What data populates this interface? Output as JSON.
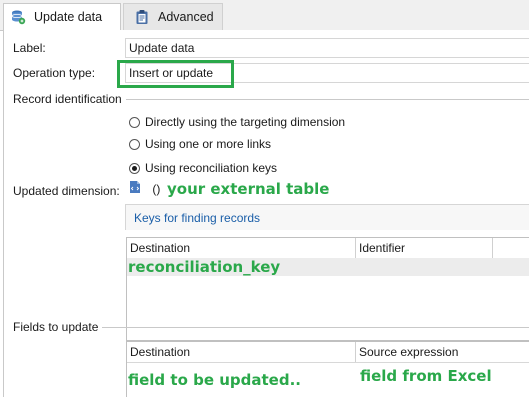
{
  "tabs": [
    {
      "label": "Update data",
      "icon": "database-icon",
      "active": true
    },
    {
      "label": "Advanced",
      "icon": "clipboard-icon",
      "active": false
    }
  ],
  "form": {
    "label_caption": "Label:",
    "label_value": "Update data",
    "operation_caption": "Operation type:",
    "operation_value": "Insert or update"
  },
  "record_identification": {
    "title": "Record identification",
    "options": [
      {
        "label": "Directly using the targeting dimension",
        "selected": false
      },
      {
        "label": "Using one or more links",
        "selected": false
      },
      {
        "label": "Using reconciliation keys",
        "selected": true
      }
    ]
  },
  "updated_dimension": {
    "caption": "Updated dimension:",
    "value": "()"
  },
  "keys": {
    "link": "Keys for finding records",
    "columns": [
      "Destination",
      "Identifier"
    ]
  },
  "fields_to_update": {
    "title": "Fields to update",
    "columns": [
      "Destination",
      "Source expression"
    ]
  },
  "annotations": {
    "external_table": "your external table",
    "reconciliation_key": "reconciliation_key",
    "field_updated": "field to be updated..",
    "field_excel": "field from Excel"
  },
  "colors": {
    "annotation_green": "#2aa84a",
    "link_blue": "#1a5ea8"
  }
}
